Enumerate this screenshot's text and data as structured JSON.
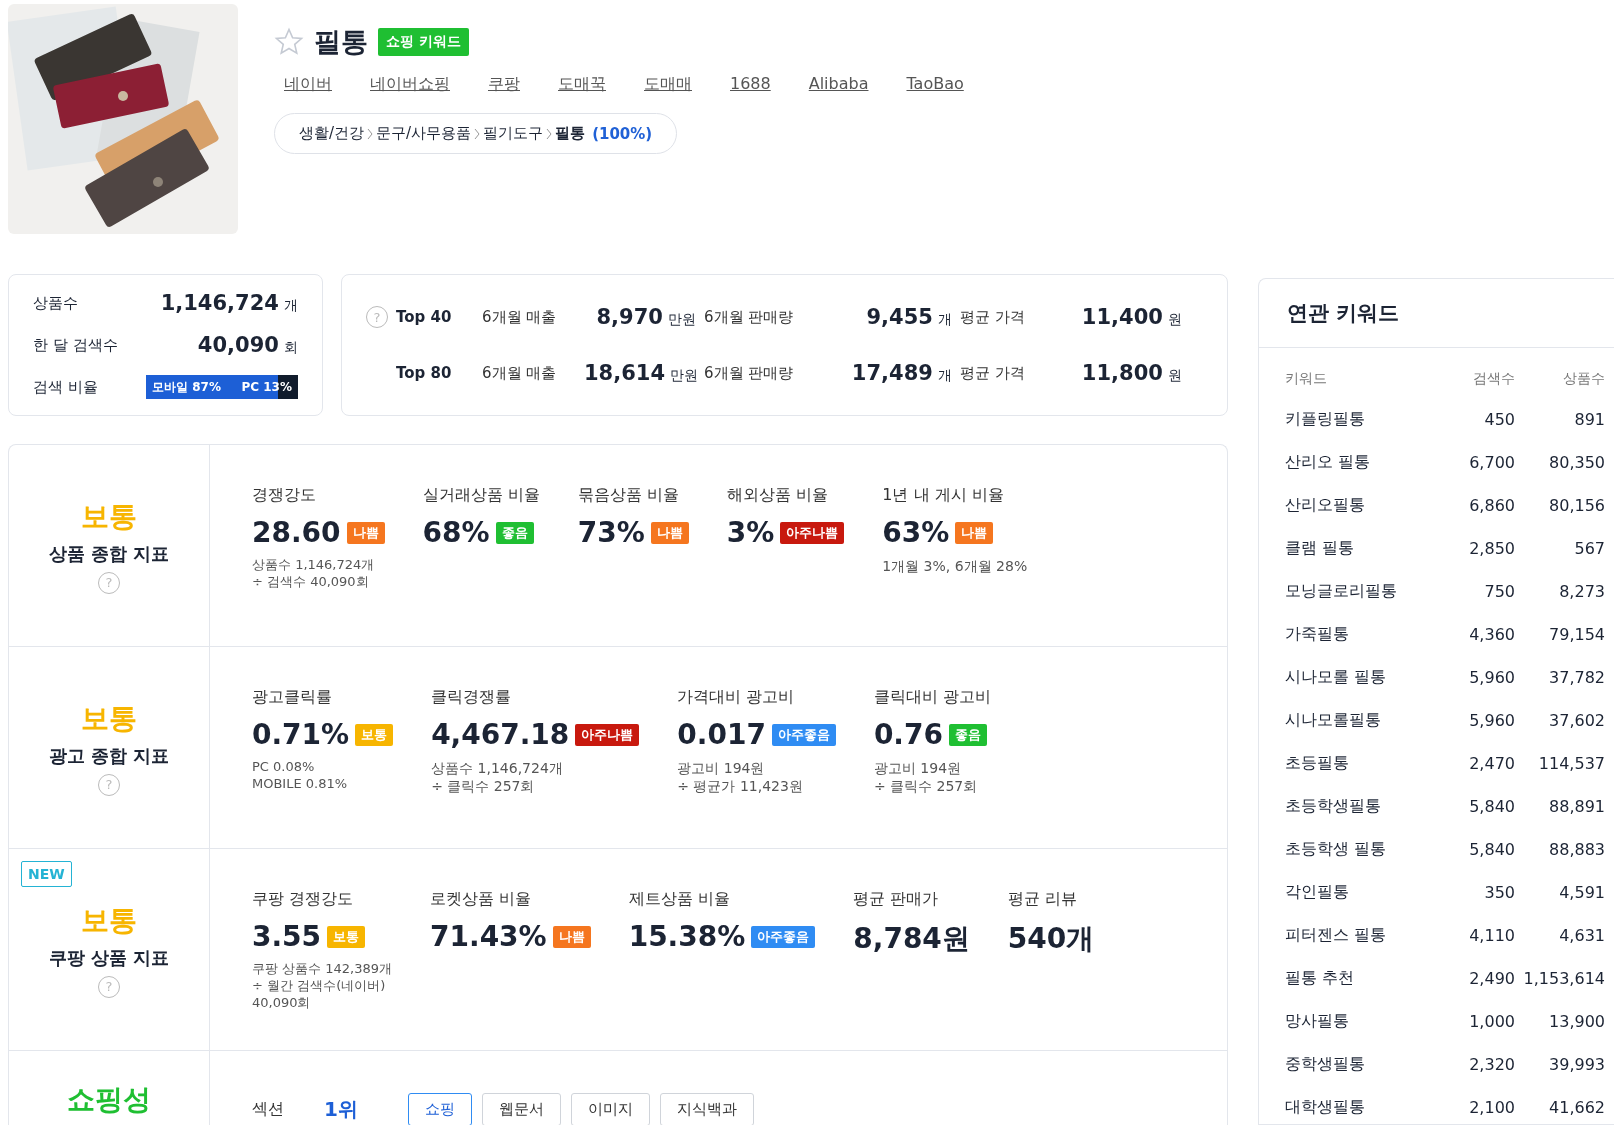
{
  "product": {
    "name": "필통",
    "favorite": false,
    "tag": "쇼핑 키워드",
    "kind": "picture"
  },
  "links": [
    "네이버",
    "네이버쇼핑",
    "쿠팡",
    "도매꾹",
    "도매매",
    "1688",
    "Alibaba",
    "TaoBao"
  ],
  "category": {
    "path": [
      "생활/건강",
      "문구/사무용품",
      "필기도구",
      "필통"
    ],
    "share": "(100%)"
  },
  "summary": [
    {
      "label": "상품수",
      "value": "1,146,724",
      "unit": "개"
    },
    {
      "label": "한 달 검색수",
      "value": "40,090",
      "unit": "회"
    }
  ],
  "search_ratio": {
    "label": "검색 비율",
    "mobile": "모바일 87%",
    "pc": "PC 13%",
    "level": 0.87
  },
  "top_stats": [
    {
      "rank": "Top 40",
      "help": "?",
      "items": [
        {
          "label": "6개월 매출",
          "value": "8,970",
          "unit": "만원"
        },
        {
          "label": "6개월 판매량",
          "value": "9,455",
          "unit": "개"
        },
        {
          "label": "평균 가격",
          "value": "11,400",
          "unit": "원"
        }
      ]
    },
    {
      "rank": "Top 80",
      "items": [
        {
          "label": "6개월 매출",
          "value": "18,614",
          "unit": "만원"
        },
        {
          "label": "6개월 판매량",
          "value": "17,489",
          "unit": "개"
        },
        {
          "label": "평균 가격",
          "value": "11,800",
          "unit": "원"
        }
      ]
    }
  ],
  "indicators": [
    {
      "kind": "metrics",
      "grade": "보통",
      "color": "#f7b500",
      "name": "상품 종합 지표",
      "help": "?",
      "metrics": [
        {
          "label": "경쟁강도",
          "value": "28.60",
          "badge": "나쁨",
          "color": "#f5761f",
          "notes": [
            "상품수 1,146,724개",
            "÷ 검색수 40,090회"
          ]
        },
        {
          "label": "실거래상품 비율",
          "value": "68%",
          "badge": "좋음",
          "color": "#1fbf32"
        },
        {
          "label": "묶음상품 비율",
          "value": "73%",
          "badge": "나쁨",
          "color": "#f5761f"
        },
        {
          "label": "해외상품 비율",
          "value": "3%",
          "badge": "아주나쁨",
          "color": "#c8190e"
        },
        {
          "label": "1년 내 게시 비율",
          "value": "63%",
          "badge": "나쁨",
          "color": "#f5761f",
          "notes": [
            "1개월 3%, 6개월 28%"
          ]
        }
      ]
    },
    {
      "kind": "metrics",
      "grade": "보통",
      "color": "#f7b500",
      "name": "광고 종합 지표",
      "help": "?",
      "metrics": [
        {
          "label": "광고클릭률",
          "value": "0.71%",
          "badge": "보통",
          "color": "#f7b500",
          "notes": [
            "PC 0.08%",
            "MOBILE 0.81%"
          ]
        },
        {
          "label": "클릭경쟁률",
          "value": "4,467.18",
          "badge": "아주나쁨",
          "color": "#c8190e",
          "notes": [
            "상품수 1,146,724개",
            "÷ 클릭수 257회"
          ]
        },
        {
          "label": "가격대비 광고비",
          "value": "0.017",
          "badge": "아주좋음",
          "color": "#2f8cf3",
          "notes": [
            "광고비 194원",
            "÷ 평균가 11,423원"
          ]
        },
        {
          "label": "클릭대비 광고비",
          "value": "0.76",
          "badge": "좋음",
          "color": "#1fbf32",
          "notes": [
            "광고비 194원",
            "÷ 클릭수 257회"
          ]
        }
      ]
    },
    {
      "kind": "metrics",
      "grade": "보통",
      "color": "#f7b500",
      "name": "쿠팡 상품 지표",
      "help": "?",
      "new_label": "NEW",
      "metrics": [
        {
          "label": "쿠팡 경쟁강도",
          "value": "3.55",
          "badge": "보통",
          "color": "#f7b500",
          "notes": [
            "쿠팡 상품수 142,389개",
            "÷ 월간 검색수(네이버)",
            "40,090회"
          ]
        },
        {
          "label": "로켓상품 비율",
          "value": "71.43%",
          "badge": "나쁨",
          "color": "#f5761f"
        },
        {
          "label": "제트상품 비율",
          "value": "15.38%",
          "badge": "아주좋음",
          "color": "#2f8cf3"
        },
        {
          "label": "평균 판매가",
          "value": "8,784원"
        },
        {
          "label": "평균 리뷰",
          "value": "540개"
        }
      ]
    },
    {
      "kind": "sections",
      "grade": "쇼핑성",
      "color": "#1fbf32",
      "label": "섹션",
      "rank": "1위",
      "tabs": [
        {
          "label": "쇼핑",
          "selected": true
        },
        {
          "label": "웹문서",
          "selected": false
        },
        {
          "label": "이미지",
          "selected": false
        },
        {
          "label": "지식백과",
          "selected": false
        }
      ]
    }
  ],
  "related": {
    "title": "연관 키워드",
    "columns": [
      "키워드",
      "검색수",
      "상품수"
    ],
    "rows": [
      [
        "키플링필통",
        "450",
        "891"
      ],
      [
        "산리오 필통",
        "6,700",
        "80,350"
      ],
      [
        "산리오필통",
        "6,860",
        "80,156"
      ],
      [
        "클램 필통",
        "2,850",
        "567"
      ],
      [
        "모닝글로리필통",
        "750",
        "8,273"
      ],
      [
        "가죽필통",
        "4,360",
        "79,154"
      ],
      [
        "시나모롤 필통",
        "5,960",
        "37,782"
      ],
      [
        "시나모롤필통",
        "5,960",
        "37,602"
      ],
      [
        "초등필통",
        "2,470",
        "114,537"
      ],
      [
        "초등학생필통",
        "5,840",
        "88,891"
      ],
      [
        "초등학생 필통",
        "5,840",
        "88,883"
      ],
      [
        "각인필통",
        "350",
        "4,591"
      ],
      [
        "피터젠스 필통",
        "4,110",
        "4,631"
      ],
      [
        "필통 추천",
        "2,490",
        "1,153,614"
      ],
      [
        "망사필통",
        "1,000",
        "13,900"
      ],
      [
        "중학생필통",
        "2,320",
        "39,993"
      ],
      [
        "대학생필통",
        "2,100",
        "41,662"
      ]
    ]
  }
}
